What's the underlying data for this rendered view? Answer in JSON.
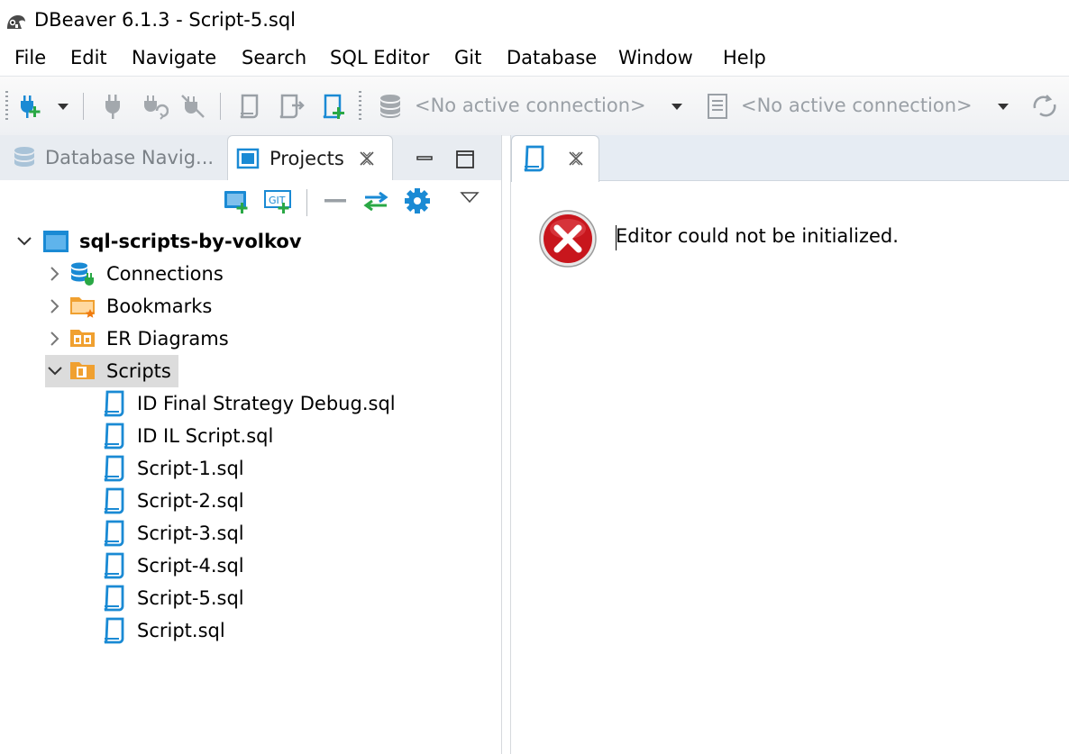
{
  "window": {
    "title": "DBeaver 6.1.3 - Script-5.sql"
  },
  "menu": [
    "File",
    "Edit",
    "Navigate",
    "Search",
    "SQL Editor",
    "Git",
    "Database",
    "Window",
    "Help"
  ],
  "toolbar": {
    "connection_combo": "<No active connection>",
    "schema_combo": "<No active connection>"
  },
  "left_tabs": {
    "navigator": "Database Navig...",
    "projects": "Projects"
  },
  "project": {
    "name": "sql-scripts-by-volkov",
    "folders": [
      "Connections",
      "Bookmarks",
      "ER Diagrams",
      "Scripts"
    ],
    "scripts": [
      "ID Final Strategy Debug.sql",
      "ID IL Script.sql",
      "Script-1.sql",
      "Script-2.sql",
      "Script-3.sql",
      "Script-4.sql",
      "Script-5.sql",
      "Script.sql"
    ]
  },
  "editor": {
    "error_message": "Editor could not be initialized."
  },
  "colors": {
    "accent_blue": "#1a8ad4",
    "folder_orange": "#f0a030",
    "error_red": "#c8161d",
    "plug_green": "#2aa845"
  }
}
